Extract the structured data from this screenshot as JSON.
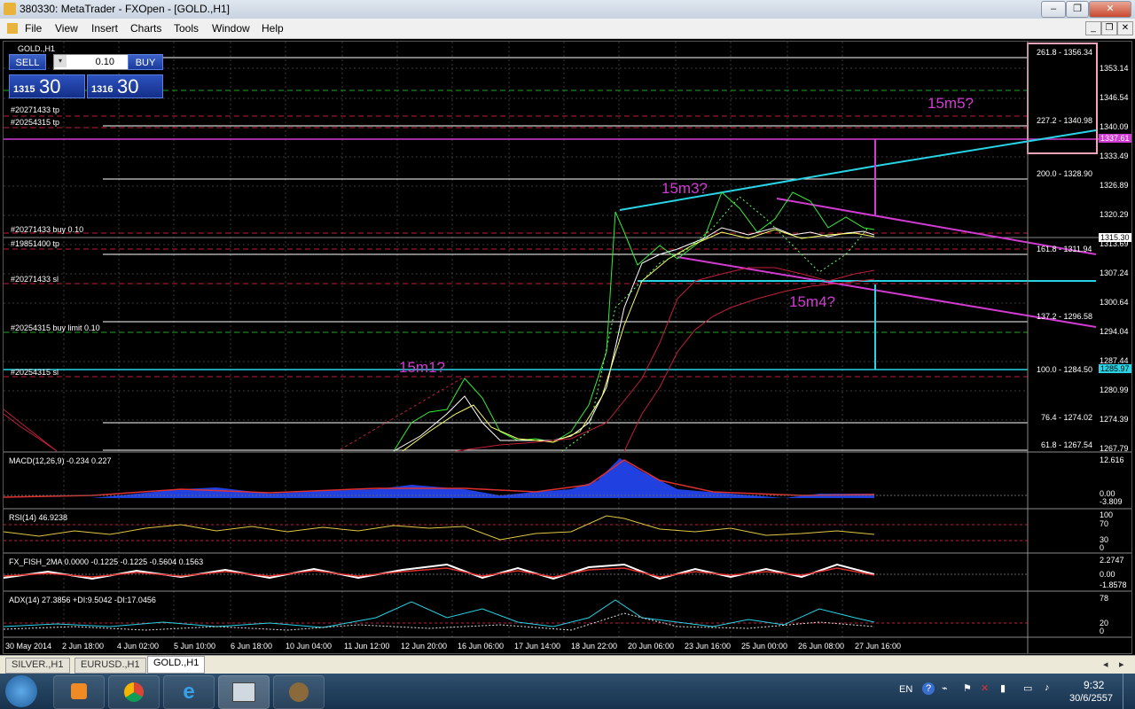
{
  "window": {
    "title": "380330: MetaTrader - FXOpen - [GOLD.,H1]",
    "buttons": {
      "minimize": "–",
      "restore": "❐",
      "close": "✕"
    }
  },
  "menu": {
    "items": [
      "File",
      "View",
      "Insert",
      "Charts",
      "Tools",
      "Window",
      "Help"
    ]
  },
  "chart": {
    "symbol_label": "GOLD.,H1",
    "trade_panel": {
      "sell_label": "SELL",
      "buy_label": "BUY",
      "lot_value": "0.10",
      "sell_small": "1315",
      "sell_big": "30",
      "buy_small": "1316",
      "buy_big": "30"
    },
    "order_labels": [
      "#20271433 tp",
      "#20254315 tp",
      "#20271433 buy 0.10",
      "#19851400 tp",
      "#20271433 sl",
      "#20254315 buy limit 0.10",
      "#20254315 sl"
    ],
    "annotations": [
      "15m5?",
      "15m3?",
      "15m4?",
      "15m1?"
    ],
    "fib_labels": [
      "261.8 - 1356.34",
      "227.2 - 1340.98",
      "200.0 - 1328.90",
      "161.8 - 1311.94",
      "137.2 - 1296.58",
      "100.0 - 1284.50",
      "76.4 - 1274.02",
      "61.8 - 1267.54"
    ],
    "price_axis": [
      "1353.14",
      "1346.54",
      "1340.09",
      "1333.49",
      "1326.89",
      "1320.29",
      "1313.69",
      "1307.24",
      "1300.64",
      "1294.04",
      "1287.44",
      "1280.99",
      "1274.39",
      "1267.79"
    ],
    "current_price": "1315.30",
    "tag_price_pink": "1337.61",
    "tag_price_cyan": "1285.97",
    "time_axis": [
      "30 May 2014",
      "2 Jun 18:00",
      "4 Jun 02:00",
      "5 Jun 10:00",
      "6 Jun 18:00",
      "10 Jun 04:00",
      "11 Jun 12:00",
      "12 Jun 20:00",
      "16 Jun 06:00",
      "17 Jun 14:00",
      "18 Jun 22:00",
      "20 Jun 06:00",
      "23 Jun 16:00",
      "25 Jun 00:00",
      "26 Jun 08:00",
      "27 Jun 16:00"
    ]
  },
  "indicators": {
    "macd": {
      "label": "MACD(12,26,9) -0.234 0.227",
      "axis": [
        "12.616",
        "0.00",
        "-3.809"
      ]
    },
    "rsi": {
      "label": "RSI(14) 46.9238",
      "axis": [
        "100",
        "70",
        "30",
        "0"
      ]
    },
    "fish": {
      "label": "FX_FISH_2MA 0.0000 -0.1225 -0.1225 -0.5604 0.1563",
      "axis": [
        "2.2747",
        "0.00",
        "-1.8578"
      ]
    },
    "adx": {
      "label": "ADX(14) 27.3856 +DI:9.5042 -DI:17.0456",
      "axis": [
        "78",
        "20",
        "0"
      ]
    }
  },
  "tabs": [
    {
      "label": "SILVER.,H1",
      "active": false
    },
    {
      "label": "EURUSD.,H1",
      "active": false
    },
    {
      "label": "GOLD.,H1",
      "active": true
    }
  ],
  "taskbar": {
    "apps": [
      "start-orb",
      "media-player",
      "chrome",
      "internet-explorer",
      "metatrader",
      "media-app"
    ],
    "lang": "EN",
    "time": "9:32",
    "date": "30/6/2557"
  },
  "colors": {
    "pink_annot": "#d23bd2",
    "cyan_line": "#27d4e6",
    "magenta_line": "#d23bd2",
    "grid": "#3a3a3a",
    "fib": "#ffffff"
  }
}
